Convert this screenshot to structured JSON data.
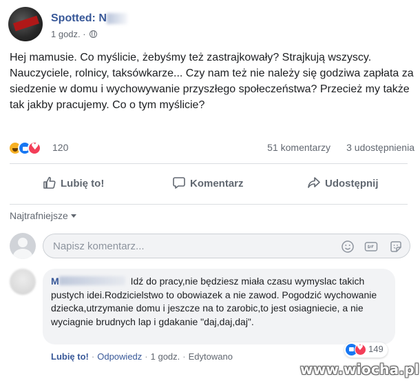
{
  "post": {
    "page_name": "Spotted: N",
    "time": "1 godz. ·",
    "text": "Hej mamusie. Co myślicie, żebyśmy też zastrajkowały? Strajkują wszyscy. Nauczyciele, rolnicy, taksówkarze... Czy nam też nie należy się godziwa zapłata za siedzenie w domu i wychowywanie przyszłego społeczeństwa? Przecież my także tak jakby pracujemy. Co o tym myślicie?",
    "reaction_count": "120",
    "comments_count": "51 komentarzy",
    "shares_count": "3 udostępnienia",
    "reaction_icons": [
      "haha-icon",
      "like-icon",
      "love-icon"
    ]
  },
  "actions": {
    "like": "Lubię to!",
    "comment": "Komentarz",
    "share": "Udostępnij"
  },
  "comments_section": {
    "sort_label": "Najtrafniejsze",
    "input_placeholder": "Napisz komentarz..."
  },
  "comment": {
    "author_initial": "M",
    "text": "Idź do pracy,nie będziesz miała czasu wymyslac takich pustych idei.Rodzicielstwo to obowiazek a nie zawod. Pogodzić wychowanie dziecka,utrzymanie domu i jeszcze na to zarobic,to jest osiagniecie, a nie wyciagnie brudnych lap i gdakanie \"daj,daj,daj\".",
    "reaction_count": "149",
    "like_label": "Lubię to!",
    "reply_label": "Odpowiedz",
    "time": "1 godz.",
    "edited_label": "Edytowano"
  },
  "watermark": "www.wiocha.pl",
  "colors": {
    "link": "#385898",
    "muted": "#616770",
    "like_blue": "#1877f2",
    "love_red": "#f33e58",
    "haha_yellow": "#f7b125"
  }
}
